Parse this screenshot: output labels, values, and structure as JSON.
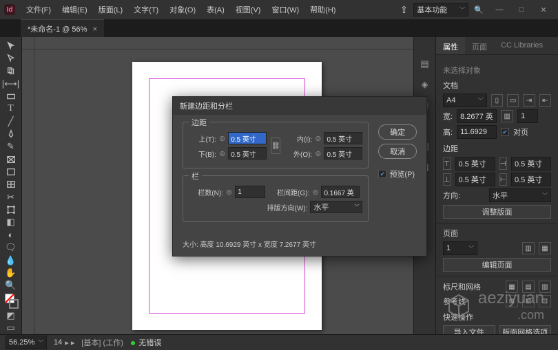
{
  "app_icon_letter": "Id",
  "menu": {
    "file": "文件(F)",
    "edit": "编辑(E)",
    "layout": "版面(L)",
    "type": "文字(T)",
    "object": "对象(O)",
    "table": "表(A)",
    "view": "视图(V)",
    "window": "窗口(W)",
    "help": "帮助(H)"
  },
  "workspace": "基本功能",
  "document_tab": "*未命名-1 @ 56%",
  "status": {
    "zoom": "56.25%",
    "nav": "14",
    "mode": "[基本] (工作)",
    "errors": "无错误"
  },
  "panel": {
    "tabs": {
      "properties": "属性",
      "pages": "页面",
      "cc": "CC Libraries"
    },
    "no_selection": "未选择对象",
    "doc_label": "文档",
    "preset": "A4",
    "width_label": "宽:",
    "width": "8.2677 英",
    "height_label": "高:",
    "height": "11.6929",
    "units": "1",
    "facing": "对页",
    "margins_label": "边距",
    "m_top": "0.5 英寸",
    "m_bottom": "0.5 英寸",
    "m_left": "0.5 英寸",
    "m_right": "0.5 英寸",
    "orient_label": "方向:",
    "orient": "水平",
    "adjust_layout": "调整版面",
    "pages_label": "页面",
    "page_count": "1",
    "edit_pages": "编辑页面",
    "rulers_label": "标尺和网格",
    "guides_label": "参考线",
    "quick_label": "快速操作",
    "import": "导入文件",
    "layout_opts": "版面网格选项"
  },
  "dialog": {
    "title": "新建边距和分栏",
    "margins_group": "边距",
    "top": "上(T):",
    "top_v": "0.5 英寸",
    "bottom": "下(B):",
    "bottom_v": "0.5 英寸",
    "inside": "内(I):",
    "inside_v": "0.5 英寸",
    "outside": "外(O):",
    "outside_v": "0.5 英寸",
    "columns_group": "栏",
    "count": "栏数(N):",
    "count_v": "1",
    "gutter": "栏间距(G):",
    "gutter_v": "0.1667 英",
    "direction": "排版方向(W):",
    "direction_v": "水平",
    "ok": "确定",
    "cancel": "取消",
    "preview": "预览(P)",
    "size_info": "大小: 高度 10.6929 英寸 x 宽度 7.2677 英寸"
  },
  "watermark": {
    "text": "aeziyuan",
    "sub": ".com"
  }
}
